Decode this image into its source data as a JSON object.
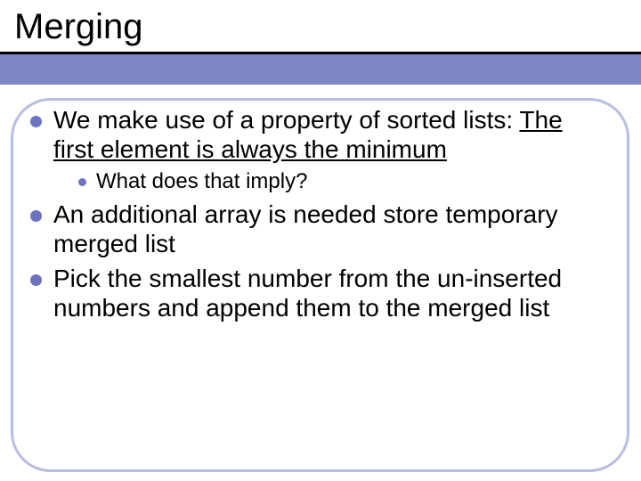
{
  "title": "Merging",
  "bullets": [
    {
      "pre": "We make use of a property of sorted lists: ",
      "underlined": "The first element is always the minimum",
      "sub": [
        {
          "text": "What does that imply?"
        }
      ]
    },
    {
      "text": "An additional array is needed store temporary merged list"
    },
    {
      "text": "Pick the smallest number from the un-inserted numbers and append them to the merged list"
    }
  ]
}
